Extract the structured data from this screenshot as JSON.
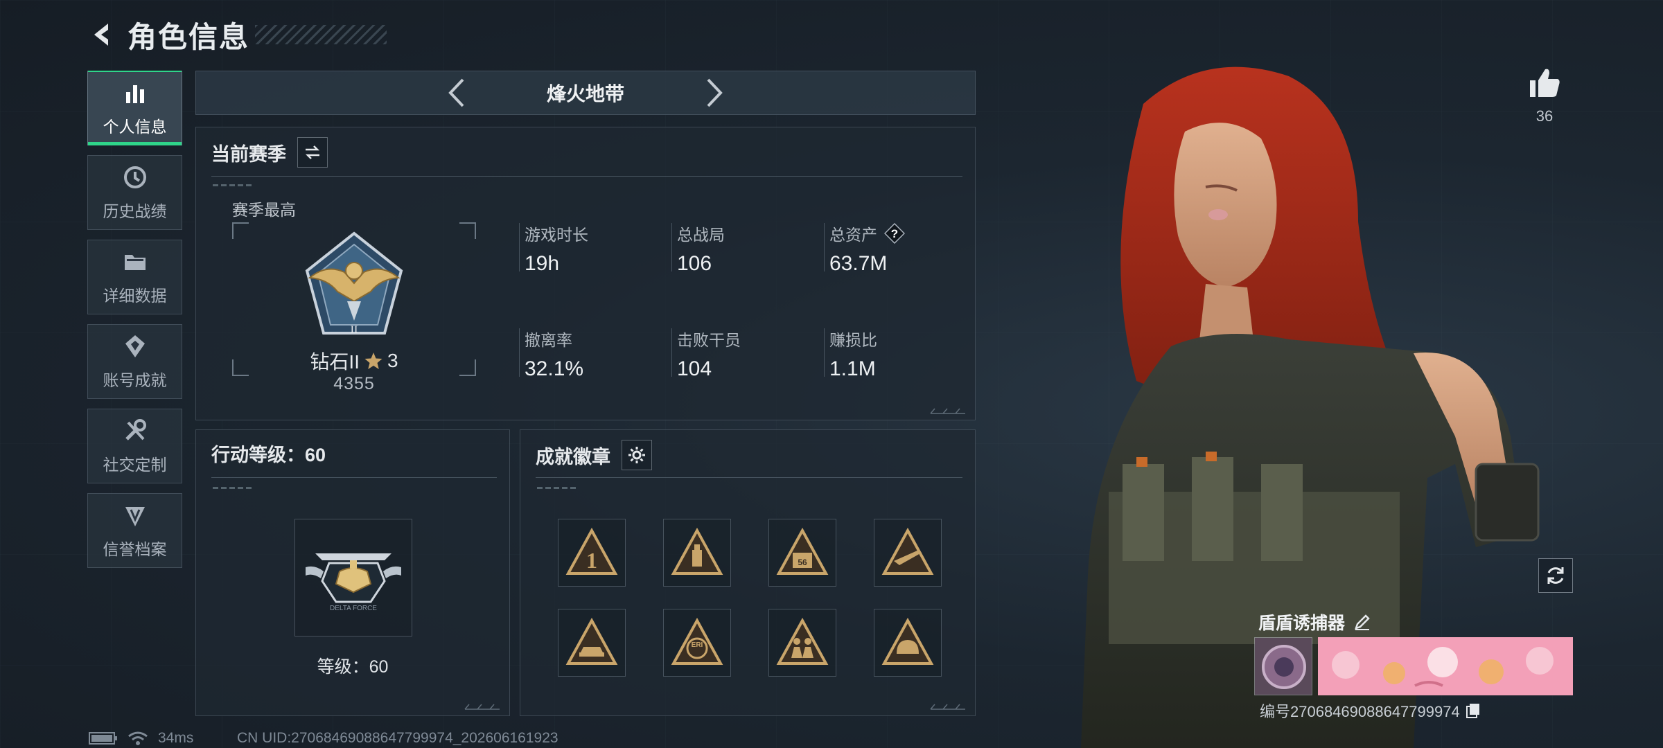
{
  "header": {
    "title": "角色信息"
  },
  "sidebar": {
    "items": [
      {
        "label": "个人信息",
        "icon": "bar-chart-icon",
        "active": true
      },
      {
        "label": "历史战绩",
        "icon": "history-icon"
      },
      {
        "label": "详细数据",
        "icon": "folder-icon"
      },
      {
        "label": "账号成就",
        "icon": "achievement-icon"
      },
      {
        "label": "社交定制",
        "icon": "tools-icon"
      },
      {
        "label": "信誉档案",
        "icon": "credit-icon"
      }
    ]
  },
  "mode_tab": {
    "title": "烽火地带"
  },
  "season": {
    "title": "当前赛季",
    "sub_title": "赛季最高",
    "rank_name": "钻石II",
    "rank_stars": "3",
    "rank_score": "4355",
    "stats": [
      {
        "label": "游戏时长",
        "value": "19h"
      },
      {
        "label": "总战局",
        "value": "106"
      },
      {
        "label": "总资产",
        "value": "63.7M",
        "help": true
      },
      {
        "label": "撤离率",
        "value": "32.1%"
      },
      {
        "label": "击败干员",
        "value": "104"
      },
      {
        "label": "赚损比",
        "value": "1.1M"
      }
    ]
  },
  "level_panel": {
    "title": "行动等级：60",
    "level_text": "等级：60"
  },
  "achievement_panel": {
    "title": "成就徽章",
    "badges": [
      "badge-rank-one-icon",
      "badge-bottle-icon",
      "badge-56-icon",
      "badge-rifle-icon",
      "badge-vehicle-icon",
      "badge-eri-icon",
      "badge-squad-icon",
      "badge-helmet-icon"
    ]
  },
  "profile": {
    "like_count": "36",
    "card_name": "盾盾诱捕器",
    "card_id": "编号2706846908864779997​4"
  },
  "status_bar": {
    "ping": "34ms",
    "uid": "CN UID:27068469088647799974_202606161923"
  },
  "colors": {
    "accent": "#2fd58a",
    "gold": "#c9a56a",
    "panel": "#1e2832"
  }
}
